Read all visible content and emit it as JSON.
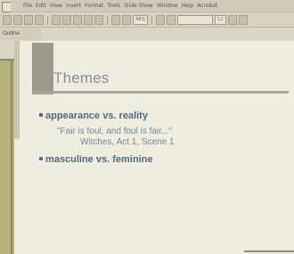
{
  "menubar": {
    "items": [
      "File",
      "Edit",
      "View",
      "Insert",
      "Format",
      "Tools",
      "Slide Show",
      "Window",
      "Help",
      "Acrobat"
    ]
  },
  "toolbar": {
    "zoom": "48%",
    "font_size": "12"
  },
  "view": {
    "label": "Outline"
  },
  "slide": {
    "title": "Themes",
    "bullet1": "appearance vs. reality",
    "quote_line1": "\"Fair is foul, and foul is fair...\"",
    "quote_line2": "Witches, Act 1, Scene 1",
    "bullet2": "masculine vs. feminine"
  },
  "colors": {
    "background": "#b9b67f",
    "slide_bg": "#efece0",
    "title": "#8a8f96",
    "bullet_text": "#4f6a80",
    "quote_text": "#6f87a0"
  }
}
